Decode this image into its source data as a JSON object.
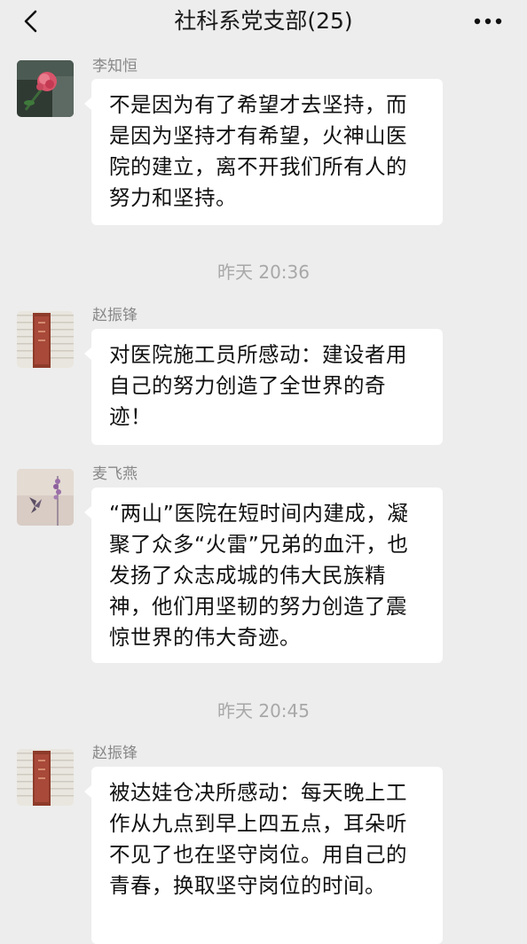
{
  "header": {
    "title": "社科系党支部(25)",
    "back_icon": "chevron-left-icon",
    "more_icon": "more-dots-icon"
  },
  "messages": [
    {
      "sender": "李知恒",
      "avatar": "rose-flower-avatar",
      "text": "不是因为有了希望才去坚持，而是因为坚持才有希望，火神山医院的建立，离不开我们所有人的努力和坚持。"
    },
    {
      "sender": "赵振锋",
      "avatar": "red-book-avatar",
      "text": "对医院施工员所感动：建设者用自己的努力创造了全世界的奇迹！"
    },
    {
      "sender": "麦飞燕",
      "avatar": "butterfly-lavender-avatar",
      "text": "“两山”医院在短时间内建成，凝聚了众多“火雷”兄弟的血汗，也发扬了众志成城的伟大民族精神，他们用坚韧的努力创造了震惊世界的伟大奇迹。"
    },
    {
      "sender": "赵振锋",
      "avatar": "red-book-avatar",
      "text": "被达娃仓决所感动：每天晚上工作从九点到早上四五点，耳朵听不见了也在坚守岗位。用自己的青春，换取坚守岗位的时间。"
    }
  ],
  "timestamps": [
    "昨天 20:36",
    "昨天 20:45"
  ],
  "colors": {
    "background": "#ededed",
    "bubble": "#ffffff",
    "sender_text": "#888888",
    "timestamp_text": "#a8a8a8"
  }
}
